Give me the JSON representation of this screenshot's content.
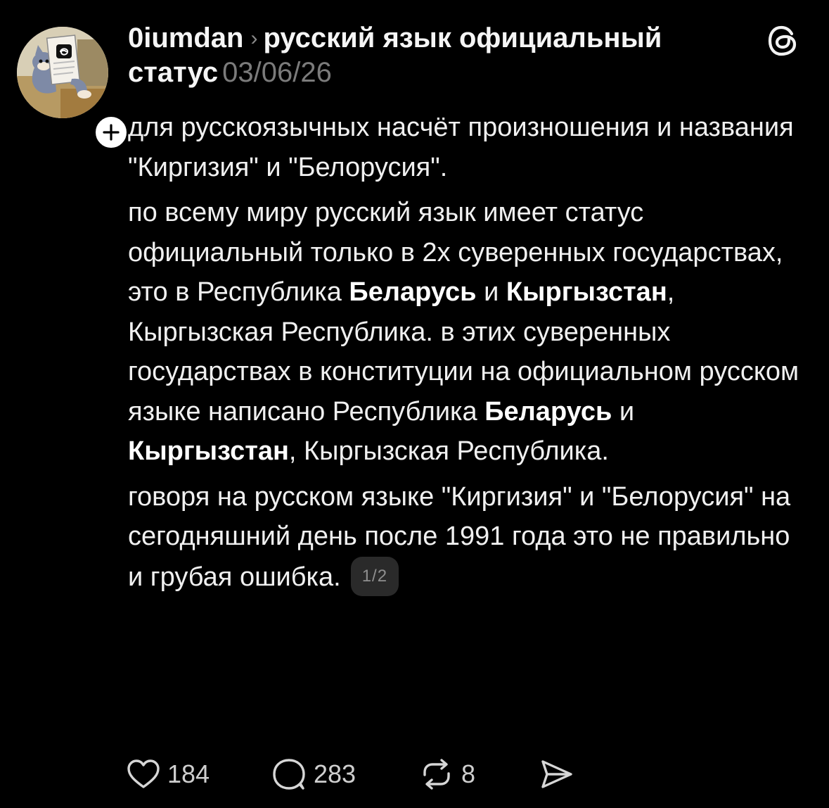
{
  "post": {
    "username": "0iumdan",
    "topic": "русский язык официальный статус",
    "date": "03/06/26",
    "paragraphs": [
      [
        {
          "text": "для русскоязычных насчёт произношения и названия \"Киргизия\" и \"Белорусия\"."
        }
      ],
      [
        {
          "text": "по всему миру русский язык имеет статус официальный только в 2х суверенных государствах, это в Республика "
        },
        {
          "text": "Беларусь",
          "bold": true
        },
        {
          "text": " и "
        },
        {
          "text": "Кыргызстан",
          "bold": true
        },
        {
          "text": ", Кыргызская Республика. в этих суверенных государствах в конституции на официальном русском языке написано Республика "
        },
        {
          "text": "Беларусь",
          "bold": true
        },
        {
          "text": " и "
        },
        {
          "text": "Кыргызстан",
          "bold": true
        },
        {
          "text": ", Кыргызская Республика."
        }
      ],
      [
        {
          "text": "говоря на русском языке \"Киргизия\" и \"Белорусия\" на сегодняшний день после 1991 года это не правильно и грубая ошибка."
        }
      ]
    ],
    "pager": "1/2"
  },
  "actions": {
    "likes": "184",
    "replies": "283",
    "reposts": "8"
  },
  "icons": {
    "follow": "plus-icon",
    "brand": "threads-logo-icon",
    "like": "heart-icon",
    "reply": "comment-bubble-icon",
    "repost": "repost-icon",
    "share": "send-icon"
  },
  "colors": {
    "background": "#000000",
    "text": "#f0f0f0",
    "muted": "#7b7b7b",
    "pager_bg": "#2a2a2a"
  }
}
